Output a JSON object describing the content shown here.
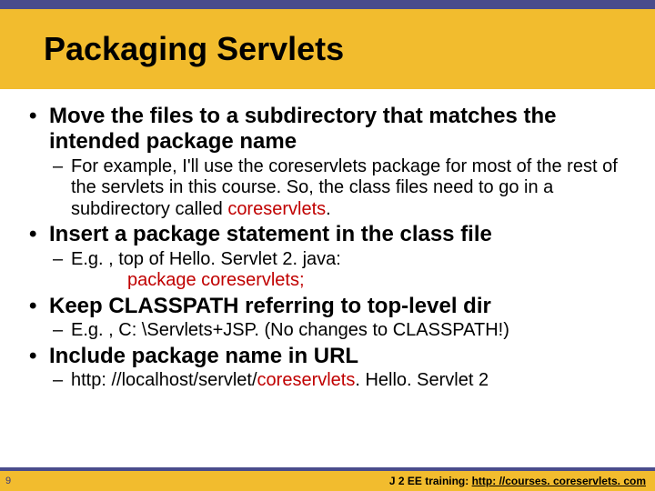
{
  "page_number": "9",
  "title": "Packaging Servlets",
  "bullets": {
    "b1": {
      "main": "Move the files to a subdirectory that matches the intended package name",
      "sub_pre": "For example, I'll use the coreservlets package for most of the rest of the servlets in this course. So, the class files need to go in a subdirectory called ",
      "sub_red": "coreservlets",
      "sub_post": "."
    },
    "b2": {
      "main": "Insert a package statement in the class file",
      "sub_pre": "E.g. , top of Hello. Servlet 2. java:",
      "code": "package coreservlets;"
    },
    "b3": {
      "main": "Keep CLASSPATH referring to top-level dir",
      "sub": "E.g. , C: \\Servlets+JSP. (No changes to CLASSPATH!)"
    },
    "b4": {
      "main": "Include package name in URL",
      "sub_pre": "http: //localhost/servlet/",
      "sub_red": "coreservlets",
      "sub_post": ". Hello. Servlet 2"
    }
  },
  "footer": {
    "label": "J 2 EE training: ",
    "url": "http: //courses. coreservlets. com"
  }
}
